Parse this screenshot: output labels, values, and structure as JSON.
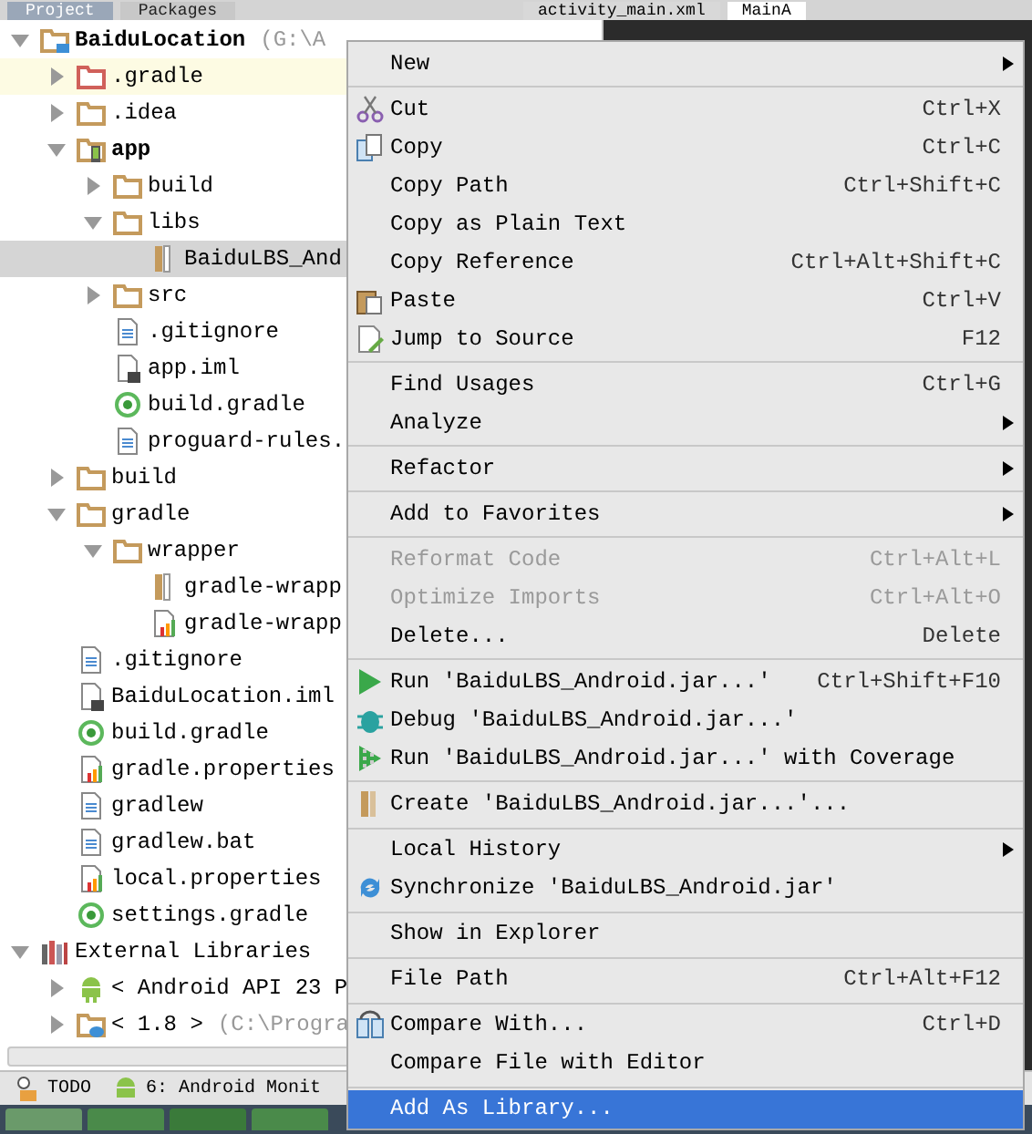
{
  "top_tabs": [
    {
      "label": "Project",
      "selected": true
    },
    {
      "label": "Packages",
      "selected": false
    }
  ],
  "editor_tabs": [
    {
      "label": "activity_main.xml",
      "selected": false
    },
    {
      "label": "MainA",
      "selected": true
    }
  ],
  "tree": [
    {
      "label": "BaiduLocation",
      "path": "(G:\\A",
      "kind": "project",
      "expanded": true,
      "selected": false,
      "highlighted": false,
      "children": [
        {
          "label": ".gradle",
          "kind": "folder-excluded",
          "expanded": false,
          "selected": false,
          "highlighted": true
        },
        {
          "label": ".idea",
          "kind": "folder",
          "expanded": false,
          "selected": false,
          "highlighted": false
        },
        {
          "label": "app",
          "kind": "module",
          "expanded": true,
          "selected": false,
          "highlighted": false,
          "children": [
            {
              "label": "build",
              "kind": "folder",
              "expanded": false,
              "selected": false,
              "highlighted": false
            },
            {
              "label": "libs",
              "kind": "folder",
              "expanded": true,
              "selected": false,
              "highlighted": false,
              "children": [
                {
                  "label": "BaiduLBS_And",
                  "kind": "jar",
                  "selected": true,
                  "highlighted": false
                }
              ]
            },
            {
              "label": "src",
              "kind": "folder",
              "expanded": false,
              "selected": false,
              "highlighted": false
            },
            {
              "label": ".gitignore",
              "kind": "text-file",
              "selected": false,
              "highlighted": false
            },
            {
              "label": "app.iml",
              "kind": "iml-file",
              "selected": false,
              "highlighted": false
            },
            {
              "label": "build.gradle",
              "kind": "gradle-file",
              "selected": false,
              "highlighted": false
            },
            {
              "label": "proguard-rules.",
              "kind": "text-file",
              "selected": false,
              "highlighted": false
            }
          ]
        },
        {
          "label": "build",
          "kind": "folder",
          "expanded": false,
          "selected": false,
          "highlighted": false
        },
        {
          "label": "gradle",
          "kind": "folder",
          "expanded": true,
          "selected": false,
          "highlighted": false,
          "children": [
            {
              "label": "wrapper",
              "kind": "folder",
              "expanded": true,
              "selected": false,
              "highlighted": false,
              "children": [
                {
                  "label": "gradle-wrapp",
                  "kind": "jar",
                  "selected": false,
                  "highlighted": false
                },
                {
                  "label": "gradle-wrapp",
                  "kind": "properties-file",
                  "selected": false,
                  "highlighted": false
                }
              ]
            }
          ]
        },
        {
          "label": ".gitignore",
          "kind": "text-file",
          "selected": false,
          "highlighted": false
        },
        {
          "label": "BaiduLocation.iml",
          "kind": "iml-file",
          "selected": false,
          "highlighted": false
        },
        {
          "label": "build.gradle",
          "kind": "gradle-file",
          "selected": false,
          "highlighted": false
        },
        {
          "label": "gradle.properties",
          "kind": "properties-file",
          "selected": false,
          "highlighted": false
        },
        {
          "label": "gradlew",
          "kind": "text-file",
          "selected": false,
          "highlighted": false
        },
        {
          "label": "gradlew.bat",
          "kind": "text-file",
          "selected": false,
          "highlighted": false
        },
        {
          "label": "local.properties",
          "kind": "properties-file",
          "selected": false,
          "highlighted": false
        },
        {
          "label": "settings.gradle",
          "kind": "gradle-file",
          "selected": false,
          "highlighted": false
        }
      ]
    },
    {
      "label": "External Libraries",
      "kind": "libraries",
      "expanded": true,
      "selected": false,
      "highlighted": false,
      "children": [
        {
          "label": "< Android API 23 P",
          "kind": "android",
          "expanded": false,
          "selected": false,
          "highlighted": false
        },
        {
          "label": "< 1.8 >",
          "path": "(C:\\Progra",
          "kind": "jdk",
          "expanded": false,
          "selected": false,
          "highlighted": false
        }
      ]
    }
  ],
  "context_menu": [
    [
      {
        "label": "New",
        "submenu": true,
        "disabled": false,
        "selected": false
      }
    ],
    [
      {
        "label": "Cut",
        "shortcut": "Ctrl+X",
        "submenu": false,
        "disabled": false,
        "selected": false
      },
      {
        "label": "Copy",
        "shortcut": "Ctrl+C",
        "submenu": false,
        "disabled": false,
        "selected": false
      },
      {
        "label": "Copy Path",
        "shortcut": "Ctrl+Shift+C",
        "submenu": false,
        "disabled": false,
        "selected": false
      },
      {
        "label": "Copy as Plain Text",
        "submenu": false,
        "disabled": false,
        "selected": false
      },
      {
        "label": "Copy Reference",
        "shortcut": "Ctrl+Alt+Shift+C",
        "submenu": false,
        "disabled": false,
        "selected": false
      },
      {
        "label": "Paste",
        "shortcut": "Ctrl+V",
        "submenu": false,
        "disabled": false,
        "selected": false
      },
      {
        "label": "Jump to Source",
        "shortcut": "F12",
        "submenu": false,
        "disabled": false,
        "selected": false
      }
    ],
    [
      {
        "label": "Find Usages",
        "shortcut": "Ctrl+G",
        "submenu": false,
        "disabled": false,
        "selected": false
      },
      {
        "label": "Analyze",
        "submenu": true,
        "disabled": false,
        "selected": false
      }
    ],
    [
      {
        "label": "Refactor",
        "submenu": true,
        "disabled": false,
        "selected": false
      }
    ],
    [
      {
        "label": "Add to Favorites",
        "submenu": true,
        "disabled": false,
        "selected": false
      }
    ],
    [
      {
        "label": "Reformat Code",
        "shortcut": "Ctrl+Alt+L",
        "submenu": false,
        "disabled": true,
        "selected": false
      },
      {
        "label": "Optimize Imports",
        "shortcut": "Ctrl+Alt+O",
        "submenu": false,
        "disabled": true,
        "selected": false
      },
      {
        "label": "Delete...",
        "shortcut": "Delete",
        "submenu": false,
        "disabled": false,
        "selected": false
      }
    ],
    [
      {
        "label": "Run 'BaiduLBS_Android.jar...'",
        "shortcut": "Ctrl+Shift+F10",
        "submenu": false,
        "disabled": false,
        "selected": false
      },
      {
        "label": "Debug 'BaiduLBS_Android.jar...'",
        "submenu": false,
        "disabled": false,
        "selected": false
      },
      {
        "label": "Run 'BaiduLBS_Android.jar...' with Coverage",
        "submenu": false,
        "disabled": false,
        "selected": false
      }
    ],
    [
      {
        "label": "Create 'BaiduLBS_Android.jar...'...",
        "submenu": false,
        "disabled": false,
        "selected": false
      }
    ],
    [
      {
        "label": "Local History",
        "submenu": true,
        "disabled": false,
        "selected": false
      },
      {
        "label": "Synchronize 'BaiduLBS_Android.jar'",
        "submenu": false,
        "disabled": false,
        "selected": false
      }
    ],
    [
      {
        "label": "Show in Explorer",
        "submenu": false,
        "disabled": false,
        "selected": false
      }
    ],
    [
      {
        "label": "File Path",
        "shortcut": "Ctrl+Alt+F12",
        "submenu": false,
        "disabled": false,
        "selected": false
      }
    ],
    [
      {
        "label": "Compare With...",
        "shortcut": "Ctrl+D",
        "submenu": false,
        "disabled": false,
        "selected": false
      },
      {
        "label": "Compare File with Editor",
        "submenu": false,
        "disabled": false,
        "selected": false
      }
    ],
    [
      {
        "label": "Add As Library...",
        "submenu": false,
        "disabled": false,
        "selected": true
      }
    ]
  ],
  "tool_windows": [
    {
      "label": "TODO",
      "kind": "todo"
    },
    {
      "label": "6: Android Monit",
      "kind": "android"
    }
  ]
}
